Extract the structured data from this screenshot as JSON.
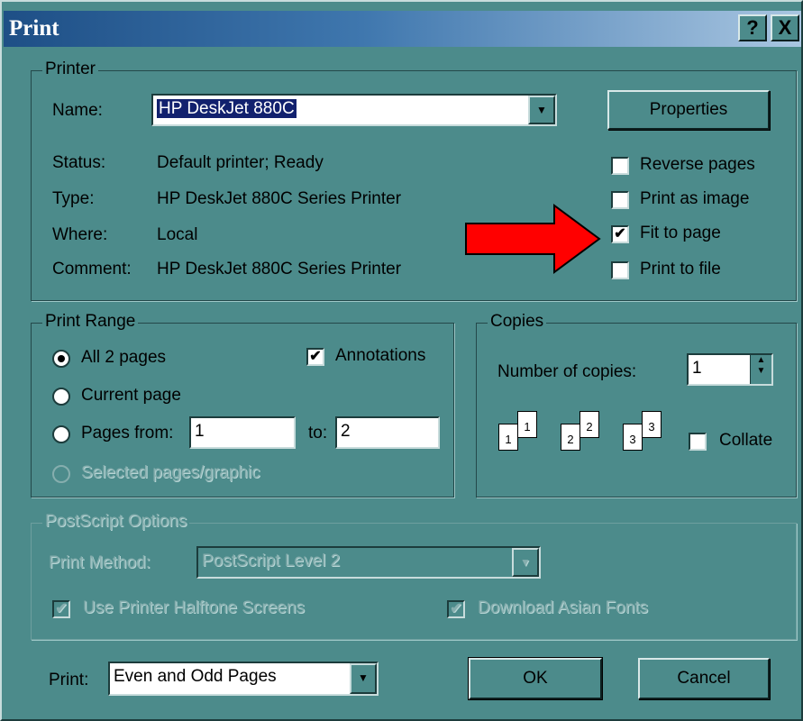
{
  "window": {
    "title": "Print",
    "help_glyph": "?",
    "close_glyph": "X"
  },
  "printer": {
    "group_label": "Printer",
    "name_label": "Name:",
    "name_value": "HP DeskJet 880C",
    "properties_button": "Properties",
    "status_label": "Status:",
    "status_value": "Default printer; Ready",
    "type_label": "Type:",
    "type_value": "HP DeskJet 880C Series Printer",
    "where_label": "Where:",
    "where_value": "Local",
    "comment_label": "Comment:",
    "comment_value": "HP DeskJet 880C Series Printer",
    "options": [
      {
        "label": "Reverse pages",
        "checked": false
      },
      {
        "label": "Print as image",
        "checked": false
      },
      {
        "label": "Fit to page",
        "checked": true
      },
      {
        "label": "Print to file",
        "checked": false
      }
    ]
  },
  "range": {
    "group_label": "Print Range",
    "all_label": "All 2 pages",
    "current_label": "Current page",
    "pages_label": "Pages from:",
    "from_value": "1",
    "to_label": "to:",
    "to_value": "2",
    "selected_label": "Selected pages/graphic",
    "annotations_label": "Annotations",
    "annotations_checked": true,
    "selected_option": "all"
  },
  "copies": {
    "group_label": "Copies",
    "number_label": "Number of copies:",
    "number_value": "1",
    "page_icons": [
      [
        "1",
        "1"
      ],
      [
        "2",
        "2"
      ],
      [
        "3",
        "3"
      ]
    ],
    "collate_label": "Collate",
    "collate_checked": false
  },
  "postscript": {
    "group_label": "PostScript Options",
    "method_label": "Print Method:",
    "method_value": "PostScript Level 2",
    "halftone_label": "Use Printer Halftone Screens",
    "asian_fonts_label": "Download Asian Fonts"
  },
  "footer": {
    "print_label": "Print:",
    "print_value": "Even and Odd Pages",
    "ok_button": "OK",
    "cancel_button": "Cancel"
  },
  "colors": {
    "dialog_bg": "#4c8b8b",
    "arrow": "#ff0000",
    "title_start": "#1e4f86",
    "title_end": "#a9c6e1"
  }
}
